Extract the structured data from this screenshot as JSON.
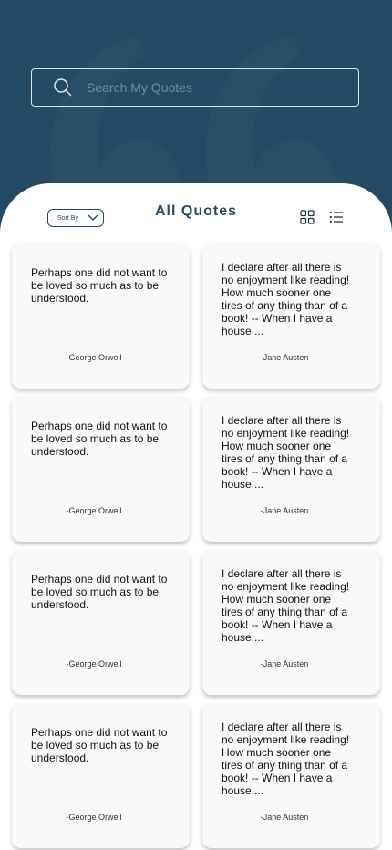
{
  "search": {
    "placeholder": "Search My Quotes"
  },
  "toolbar": {
    "sort_label": "Sort By",
    "title": "All Quotes"
  },
  "colors": {
    "header_bg": "#254a63",
    "panel_bg": "#ffffff",
    "card_bg": "#f9f9f9",
    "accent": "#2a4d63"
  },
  "icons": [
    "search-icon",
    "chevron-down-icon",
    "grid-view-icon",
    "list-view-icon"
  ],
  "quotes": [
    {
      "text": "Perhaps one did not want to be loved so much as to be understood.",
      "author": "-George Orwell"
    },
    {
      "text": "I declare after all there is no enjoyment like reading! How much sooner one tires of any thing than of a book! -- When I have a house....",
      "author": "-Jane Austen"
    },
    {
      "text": "Perhaps one did not want to be loved so much as to be understood.",
      "author": "-George Orwell"
    },
    {
      "text": "I declare after all there is no enjoyment like reading! How much sooner one tires of any thing than of a book! -- When I have a house....",
      "author": "-Jane Austen"
    },
    {
      "text": "Perhaps one did not want to be loved so much as to be understood.",
      "author": "-George Orwell"
    },
    {
      "text": "I declare after all there is no enjoyment like reading! How much sooner one tires of any thing than of a book! -- When I have a house....",
      "author": "-Jane Austen"
    },
    {
      "text": "Perhaps one did not want to be loved so much as to be understood.",
      "author": "-George Orwell"
    },
    {
      "text": "I declare after all there is no enjoyment like reading! How much sooner one tires of any thing than of a book! -- When I have a house....",
      "author": "-Jane Austen"
    }
  ]
}
